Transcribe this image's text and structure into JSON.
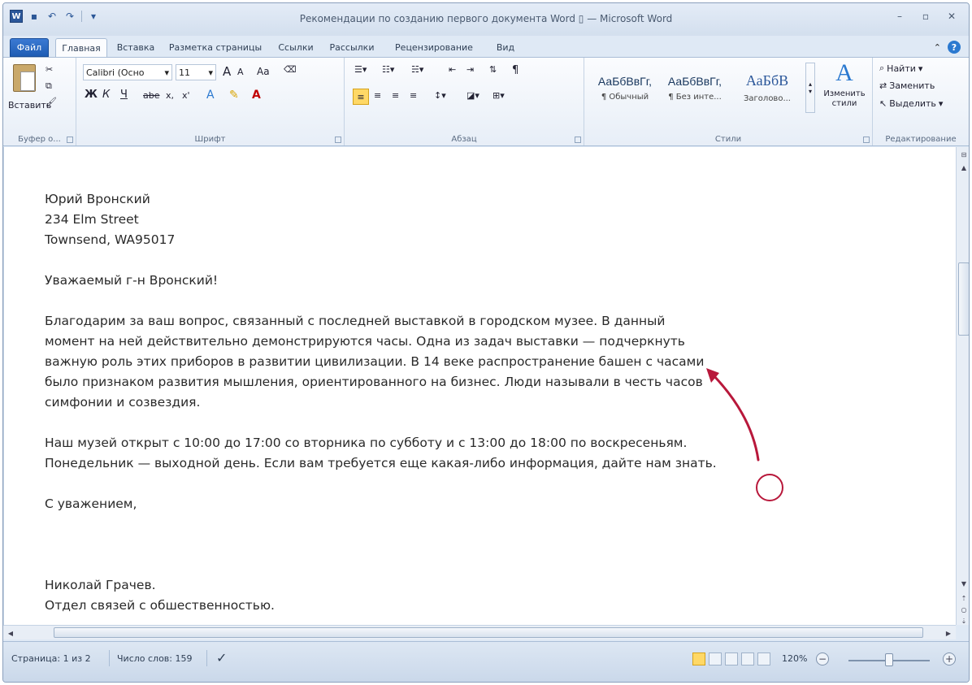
{
  "window": {
    "title": "Рекомендации по созданию первого документа Word ▯ — Microsoft Word"
  },
  "tabs": [
    {
      "label": "Файл"
    },
    {
      "label": "Главная"
    },
    {
      "label": "Вставка"
    },
    {
      "label": "Разметка страницы"
    },
    {
      "label": "Ссылки"
    },
    {
      "label": "Рассылки"
    },
    {
      "label": "Рецензирование"
    },
    {
      "label": "Вид"
    }
  ],
  "ribbon": {
    "clipboard": {
      "paste": "Вставить",
      "label": "Буфер о..."
    },
    "font": {
      "family": "Calibri (Осно",
      "size": "11",
      "label": "Шрифт",
      "grow": "A",
      "shrink": "A",
      "case": "Aa",
      "bold": "Ж",
      "italic": "К",
      "underline": "Ч",
      "strike": "abe",
      "subscript": "x,",
      "superscript": "x'"
    },
    "paragraph": {
      "label": "Абзац",
      "pilcrow": "¶"
    },
    "styles": {
      "label": "Стили",
      "items": [
        {
          "sample": "АаБбВвГг,",
          "name": "¶ Обычный"
        },
        {
          "sample": "АаБбВвГг,",
          "name": "¶ Без инте..."
        },
        {
          "sample": "АаБбВ",
          "name": "Заголово..."
        }
      ],
      "change": "Изменить стили"
    },
    "editing": {
      "label": "Редактирование",
      "find": "Найти",
      "replace": "Заменить",
      "select": "Выделить"
    }
  },
  "document": {
    "address": [
      "Юрий Вронский",
      "234 Elm Street",
      "Townsend, WA95017"
    ],
    "greeting": "Уважаемый г-н Вронский!",
    "paragraph1": [
      "Благодарим за ваш вопрос, связанный с последней выставкой в городском музее. В данный",
      "момент на ней действительно демонстрируются часы. Одна из задач выставки — подчеркнуть",
      "важную роль этих приборов в развитии цивилизации. В 14 веке распространение башен с часами",
      "было признаком развития мышления, ориентированного на бизнес. Люди называли в честь часов",
      "симфонии и созвездия."
    ],
    "paragraph2": [
      "Наш музей открыт с 10:00 до 17:00 со вторника по субботу и с 13:00 до 18:00 по воскресеньям.",
      "Понедельник — выходной день. Если вам требуется еще какая-либо информация, дайте нам знать."
    ],
    "closing": "С уважением,",
    "signature": [
      "Николай Грачев.",
      "Отдел связей с обшественностью."
    ]
  },
  "statusbar": {
    "page": "Страница: 1 из 2",
    "words": "Число слов: 159",
    "zoom": "120%",
    "zoom_level": 1.2
  },
  "colors": {
    "accent": "#2b79d0",
    "annotation": "#b8183b"
  }
}
